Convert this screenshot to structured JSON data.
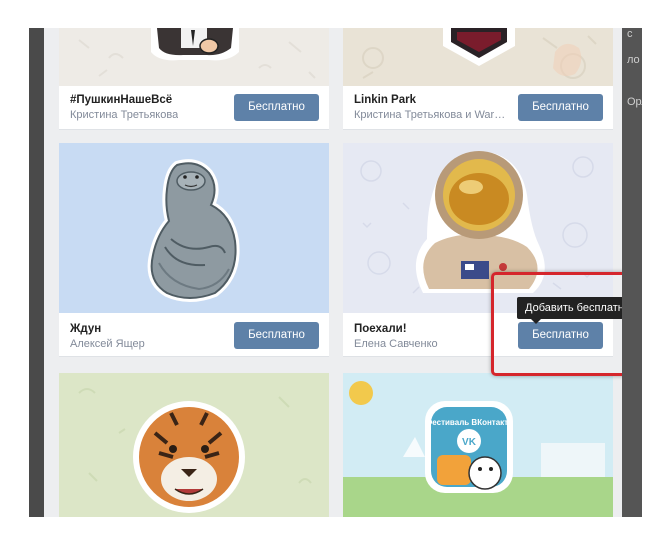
{
  "stickers": [
    {
      "title": "#ПушкинНашеВсё",
      "author": "Кристина Третьякова",
      "button": "Бесплатно"
    },
    {
      "title": "Linkin Park",
      "author": "Кристина Третьякова и Warner Music",
      "button": "Бесплатно"
    },
    {
      "title": "Ждун",
      "author": "Алексей Ящер",
      "button": "Бесплатно"
    },
    {
      "title": "Поехали!",
      "author": "Елена Савченко",
      "button": "Бесплатно"
    },
    {
      "title": "",
      "author": "",
      "button": ""
    },
    {
      "title": "Фестиваль ВКонтакте",
      "author": "",
      "button": ""
    }
  ],
  "tooltip": "Добавить бесплатно",
  "right_strip": {
    "items": [
      "с",
      "ло",
      "Орл"
    ]
  },
  "colors": {
    "button": "#5e81a8",
    "highlight": "#d5262c",
    "page_bg": "#edeef0"
  }
}
